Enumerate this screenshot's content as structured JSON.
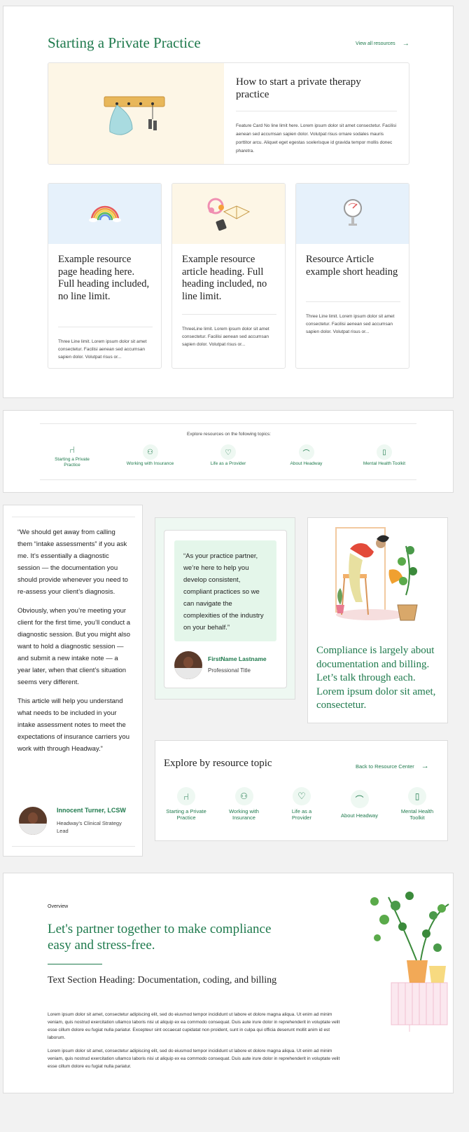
{
  "section1": {
    "title": "Starting a Private Practice",
    "view_all": "View all resources",
    "feature": {
      "heading": "How to start a private therapy practice",
      "body": "Feature Card No line limit here. Lorem ipsum dolor sit amet consectetur. Facilisi aenean sed accumsan sapien dolor. Volutpat risus ornare sodales mauris porttitor arcu. Aliquet eget egestas scelerisque id gravida tempor mollis donec pharetra."
    },
    "cards": [
      {
        "heading": "Example resource page heading here. Full heading included, no line limit.",
        "body": "Three Line limit. Lorem ipsum dolor sit amet consectetur. Facilisi aenean sed accumsan sapien dolor. Volutpat risus or...",
        "image": "rainbow-illustration"
      },
      {
        "heading": "Example resource article heading. Full heading included, no line limit.",
        "body": "ThreeLine limit. Lorem ipsum dolor sit amet consectetur. Facilisi aenean sed accumsan sapien dolor. Volutpat risus or...",
        "image": "headphones-book-phone-illustration"
      },
      {
        "heading": "Resource Article example short heading",
        "body": "Three Line limit. Lorem ipsum dolor sit amet consectetur. Facilisi aenean sed accumsan sapien dolor. Volutpat risus or...",
        "image": "pressure-gauge-illustration"
      }
    ]
  },
  "topics_bar": {
    "label": "Explore resources on the following topics:",
    "items": [
      {
        "label": "Starting a Private Practice",
        "icon": "chair-icon"
      },
      {
        "label": "Working with Insurance",
        "icon": "people-icon"
      },
      {
        "label": "Life as a Provider",
        "icon": "heart-icon"
      },
      {
        "label": "About Headway",
        "icon": "arch-icon"
      },
      {
        "label": "Mental Health Toolkit",
        "icon": "document-icon"
      }
    ]
  },
  "quote_long": {
    "p1": "“We should get away from calling them “intake assessments” if you ask me. It’s essentially a diagnostic session — the documentation you should provide whenever you need to re-assess your client’s diagnosis.",
    "p2": "Obviously, when you’re meeting your client for the first time, you’ll conduct a diagnostic session. But you might also want to hold a diagnostic session — and submit a new intake note — a year later, when that client’s situation seems very different.",
    "p3": "This article will help you understand what needs to be included in your intake assessment notes to meet the expectations of insurance carriers you work with through Headway.”",
    "author_name": "Innocent Turner, LCSW",
    "author_title": "Headway’s Clinical Strategy Lead"
  },
  "quote_short": {
    "text": "“As your practice partner, we’re here to help you develop consistent, compliant practices so we can navigate the complexities of the industry on your behalf.”",
    "author_name": "FirstName Lastname",
    "author_title": "Professional Title"
  },
  "compliance_card": {
    "text": "Compliance is largely about documentation and billing. Let’s talk through each. Lorem ipsum dolor sit amet, consectetur."
  },
  "explore_topic": {
    "title": "Explore by resource topic",
    "back_link": "Back to Resource Center",
    "items": [
      {
        "label": "Starting a Private Practice",
        "icon": "chair-icon"
      },
      {
        "label": "Working with Insurance",
        "icon": "people-icon"
      },
      {
        "label": "Life as a Provider",
        "icon": "heart-icon"
      },
      {
        "label": "About Headway",
        "icon": "arch-icon"
      },
      {
        "label": "Mental Health Toolkit",
        "icon": "document-icon"
      }
    ]
  },
  "overview": {
    "eyebrow": "Overview",
    "heading": "Let's partner together to make compliance easy and stress-free.",
    "subheading": "Text Section Heading: Documentation, coding, and billing",
    "p1": "Lorem ipsum dolor sit amet, consectetur adipiscing elit, sed do eiusmod tempor incididunt ut labore et dolore magna aliqua. Ut enim ad minim veniam, quis nostrud exercitation ullamco laboris nisi ut aliquip ex ea commodo consequat. Duis aute irure dolor in reprehenderit in voluptate velit esse cillum dolore eu fugiat nulla pariatur. Excepteur sint occaecat cupidatat non proident, sunt in culpa qui officia deserunt mollit anim id est laborum.",
    "p2": "Lorem ipsum dolor sit amet, consectetur adipiscing elit, sed do eiusmod tempor incididunt ut labore et dolore magna aliqua. Ut enim ad minim veniam, quis nostrud exercitation ullamco laboris nisi ut aliquip ex ea commodo consequat. Duis aute irure dolor in reprehenderit in voluptate velit esse cillum dolore eu fugiat nulla pariatur."
  },
  "colors": {
    "brand_green": "#1f7a4d",
    "cream": "#fdf6e6",
    "light_blue": "#e6f1fb",
    "mint": "#e8f7ee"
  }
}
